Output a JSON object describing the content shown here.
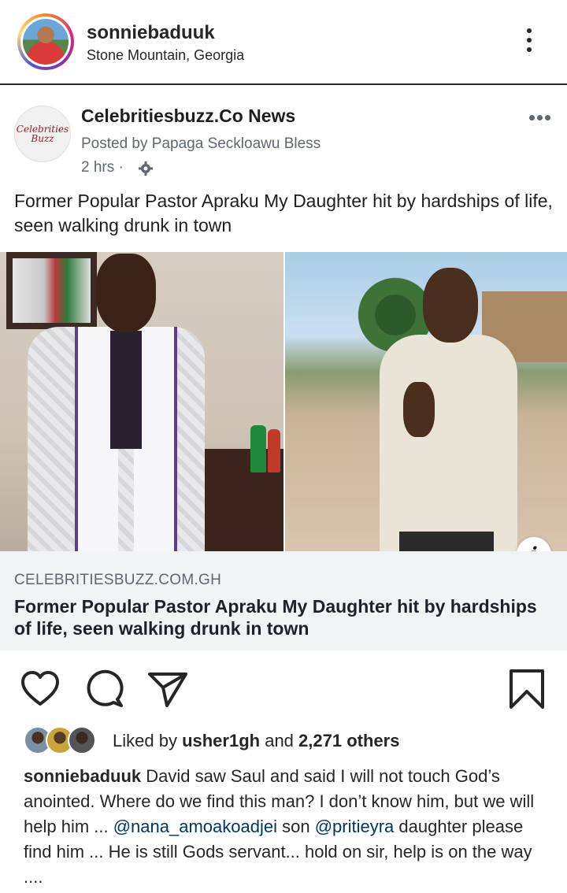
{
  "header": {
    "username": "sonniebaduuk",
    "location": "Stone Mountain, Georgia"
  },
  "fb_post": {
    "page_name": "Celebritiesbuzz.Co News",
    "logo_text": "Celebrities Buzz",
    "posted_by": "Posted by Papaga Seckloawu Bless",
    "time": "2 hrs ·",
    "caption": "Former Popular Pastor Apraku My Daughter hit by hardships of life, seen walking drunk in town",
    "info_icon": "i",
    "link": {
      "domain": "CELEBRITIESBUZZ.COM.GH",
      "title": "Former Popular Pastor Apraku My Daughter hit by hardships of life, seen walking drunk in town"
    }
  },
  "likes": {
    "prefix": "Liked by ",
    "user": "usher1gh",
    "middle": " and ",
    "count": "2,271 others"
  },
  "comment": {
    "author": "sonniebaduuk",
    "text_1": " David saw Saul and said I will not touch God’s anointed. Where do we find this man? I don’t know him, but we will help him ... ",
    "mention_1": "@nana_amoakoadjei",
    "text_2": " son ",
    "mention_2": "@pritieyra",
    "text_3": " daughter please find him ... He is still Gods servant... hold on sir, help is on the way ...."
  },
  "icons": {
    "more": "more-vertical-icon",
    "fb_more": "more-horizontal-icon",
    "gear": "gear-icon",
    "like": "heart-icon",
    "comment": "comment-icon",
    "share": "send-icon",
    "save": "bookmark-icon",
    "info": "info-icon"
  },
  "colors": {
    "mention": "#003569",
    "link_box_bg": "#f2f3f5",
    "secondary_text": "#606770"
  }
}
